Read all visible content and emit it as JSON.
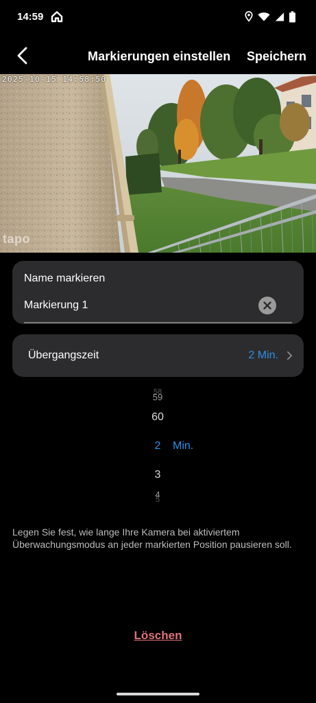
{
  "status_bar": {
    "time": "14:59",
    "icons": [
      "home-icon",
      "location-icon",
      "wifi-icon",
      "signal-icon",
      "battery-icon"
    ]
  },
  "header": {
    "back_icon": "arrow-left-icon",
    "title": "Markierungen einstellen",
    "save_label": "Speichern"
  },
  "camera": {
    "timestamp": "2025-10-15 14:58:50",
    "brand": "tapo"
  },
  "name_card": {
    "label": "Name markieren",
    "value": "Markierung 1",
    "clear_icon": "clear-icon"
  },
  "transition": {
    "label": "Übergangszeit",
    "value": "2 Min.",
    "chevron_icon": "chevron-right-icon"
  },
  "picker": {
    "items": [
      "58",
      "59",
      "60",
      "2",
      "3",
      "4",
      "5"
    ],
    "selected": "2",
    "unit": "Min."
  },
  "description": "Legen Sie fest, wie lange Ihre Kamera bei aktiviertem Überwachungsmodus an jeder markierten Position pausieren soll.",
  "delete_label": "Löschen",
  "colors": {
    "accent": "#2f8fe6",
    "danger": "#e0737a",
    "card": "#2c2c2e",
    "background": "#000000"
  }
}
